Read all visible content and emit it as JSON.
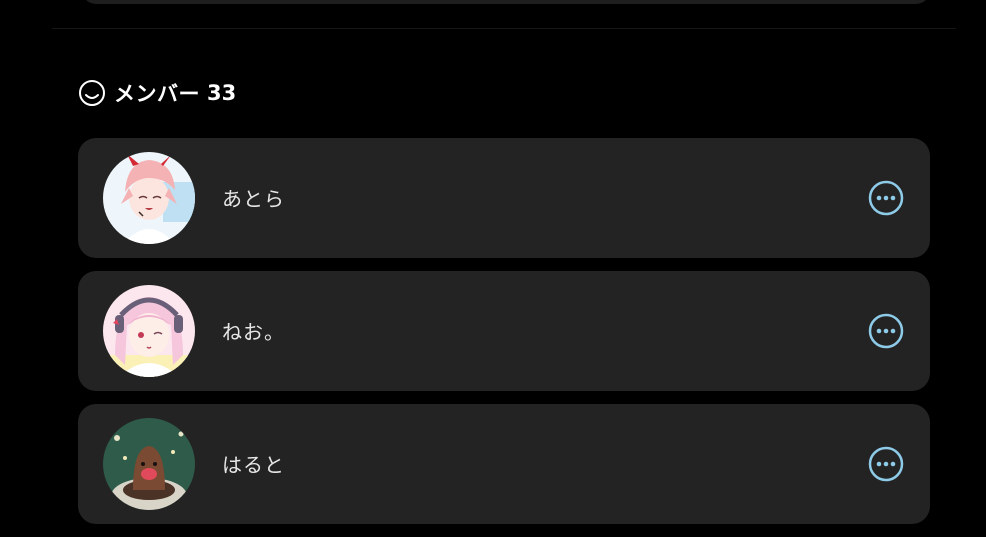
{
  "section": {
    "title": "メンバー",
    "count": "33"
  },
  "members": [
    {
      "name": "あとら",
      "avatar": "avatar-pink-hair-horns"
    },
    {
      "name": "ねお。",
      "avatar": "avatar-pink-hair-headphones"
    },
    {
      "name": "はると",
      "avatar": "avatar-brown-mole-creature"
    }
  ],
  "colors": {
    "background": "#000000",
    "card": "#232323",
    "accent": "#8ecbe8",
    "text": "#e6e6e6"
  }
}
